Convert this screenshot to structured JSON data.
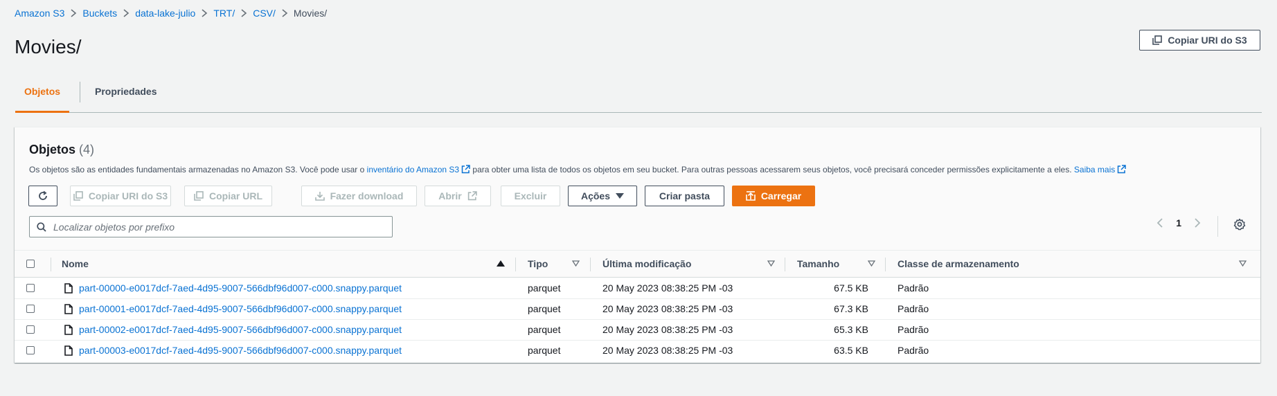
{
  "breadcrumb": [
    "Amazon S3",
    "Buckets",
    "data-lake-julio",
    "TRT/",
    "CSV/",
    "Movies/"
  ],
  "page": {
    "title": "Movies/",
    "copy_uri_label": "Copiar URI do S3"
  },
  "tabs": [
    {
      "label": "Objetos",
      "active": true
    },
    {
      "label": "Propriedades",
      "active": false
    }
  ],
  "objects_panel": {
    "title": "Objetos",
    "count": "(4)",
    "desc_part1": "Os objetos são as entidades fundamentais armazenadas no Amazon S3. Você pode usar o",
    "desc_link1": "inventário do Amazon S3",
    "desc_part2": "para obter uma lista de todos os objetos em seu bucket. Para outras pessoas acessarem seus objetos, você precisará conceder permissões explicitamente a eles.",
    "desc_link2": "Saiba mais",
    "buttons": {
      "copy_uri": "Copiar URI do S3",
      "copy_url": "Copiar URL",
      "download": "Fazer download",
      "open": "Abrir",
      "delete": "Excluir",
      "actions": "Ações",
      "create_folder": "Criar pasta",
      "upload": "Carregar"
    },
    "search_placeholder": "Localizar objetos por prefixo",
    "current_page": "1"
  },
  "table": {
    "columns": [
      "Nome",
      "Tipo",
      "Última modificação",
      "Tamanho",
      "Classe de armazenamento"
    ],
    "rows": [
      {
        "name": "part-00000-e0017dcf-7aed-4d95-9007-566dbf96d007-c000.snappy.parquet",
        "type": "parquet",
        "modified": "20 May 2023 08:38:25 PM -03",
        "size": "67.5 KB",
        "class": "Padrão"
      },
      {
        "name": "part-00001-e0017dcf-7aed-4d95-9007-566dbf96d007-c000.snappy.parquet",
        "type": "parquet",
        "modified": "20 May 2023 08:38:25 PM -03",
        "size": "67.3 KB",
        "class": "Padrão"
      },
      {
        "name": "part-00002-e0017dcf-7aed-4d95-9007-566dbf96d007-c000.snappy.parquet",
        "type": "parquet",
        "modified": "20 May 2023 08:38:25 PM -03",
        "size": "65.3 KB",
        "class": "Padrão"
      },
      {
        "name": "part-00003-e0017dcf-7aed-4d95-9007-566dbf96d007-c000.snappy.parquet",
        "type": "parquet",
        "modified": "20 May 2023 08:38:25 PM -03",
        "size": "63.5 KB",
        "class": "Padrão"
      }
    ]
  },
  "colors": {
    "accent": "#ec7211",
    "link": "#0972d3",
    "text": "#16191f"
  }
}
